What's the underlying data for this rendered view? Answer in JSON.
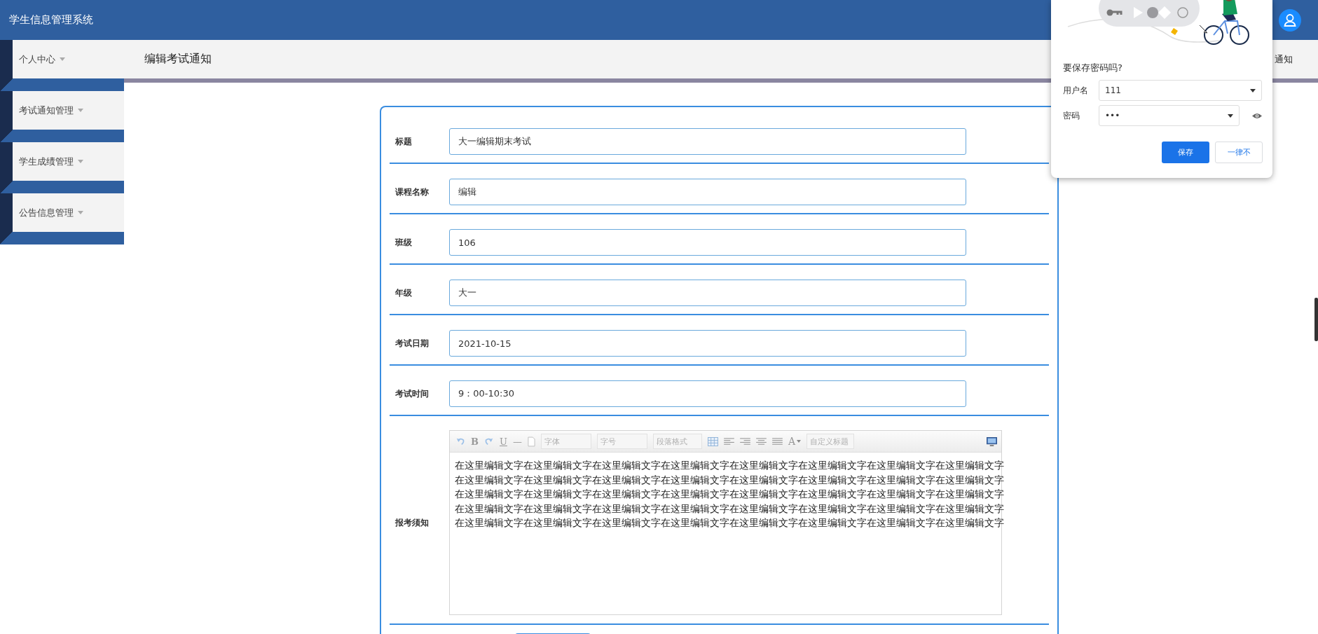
{
  "header": {
    "title": "学生信息管理系统"
  },
  "sidebar": {
    "items": [
      {
        "label": "个人中心"
      },
      {
        "label": "考试通知管理"
      },
      {
        "label": "学生成绩管理"
      },
      {
        "label": "公告信息管理"
      }
    ]
  },
  "breadcrumb": {
    "title": "编辑考试通知",
    "right_text": "通知"
  },
  "form": {
    "fields": [
      {
        "label": "标题",
        "value": "大一编辑期末考试"
      },
      {
        "label": "课程名称",
        "value": "编辑"
      },
      {
        "label": "班级",
        "value": "106"
      },
      {
        "label": "年级",
        "value": "大一"
      },
      {
        "label": "考试日期",
        "value": "2021-10-15"
      },
      {
        "label": "考试时间",
        "value": "9：00-10:30"
      }
    ],
    "editor": {
      "label": "报考须知",
      "toolbar": {
        "bold": "B",
        "underline": "U",
        "rule": "—",
        "font": "字体",
        "size": "字号",
        "paragraph": "段落格式",
        "font_color": "A",
        "heading": "自定义标题"
      },
      "content": "在这里编辑文字在这里编辑文字在这里编辑文字在这里编辑文字在这里编辑文字在这里编辑文字在这里编辑文字在这里编辑文字在这里编辑文字在这里编辑文字在这里编辑文字在这里编辑文字在这里编辑文字在这里编辑文字在这里编辑文字在这里编辑文字在这里编辑文字在这里编辑文字在这里编辑文字在这里编辑文字在这里编辑文字在这里编辑文字在这里编辑文字在这里编辑文字在这里编辑文字在这里编辑文字在这里编辑文字在这里编辑文字在这里编辑文字在这里编辑文字在这里编辑文字在这里编辑文字在这里编辑文字在这里编辑文字在这里编辑文字在这里编辑文字在这里编辑文字在这里编辑文字在这里编辑文字在这里编辑文字"
    }
  },
  "password_popup": {
    "title": "要保存密码吗?",
    "username_label": "用户名",
    "username": "111",
    "password_label": "密码",
    "password": "•••",
    "save_button": "保存",
    "never_button": "一律不"
  }
}
